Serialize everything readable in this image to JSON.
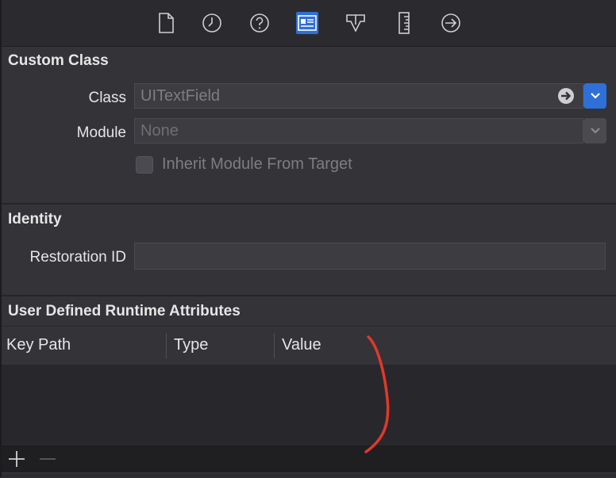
{
  "toolbar": {
    "icons": [
      "file-inspector-icon",
      "history-inspector-icon",
      "quick-help-icon",
      "identity-inspector-icon",
      "attributes-inspector-icon",
      "size-inspector-icon",
      "connections-inspector-icon"
    ],
    "active": "identity-inspector-icon",
    "accent": "#2f6fd8"
  },
  "custom_class": {
    "title": "Custom Class",
    "class_label": "Class",
    "class_value": "UITextField",
    "module_label": "Module",
    "module_placeholder": "None",
    "inherit_label": "Inherit Module From Target",
    "inherit_checked": false
  },
  "identity": {
    "title": "Identity",
    "restoration_label": "Restoration ID",
    "restoration_value": ""
  },
  "runtime_attributes": {
    "title": "User Defined Runtime Attributes",
    "columns": [
      "Key Path",
      "Type",
      "Value"
    ],
    "rows": [],
    "add_icon": "plus-icon",
    "remove_icon": "minus-icon"
  },
  "colors": {
    "background": "#333338",
    "annotation": "#e0392b"
  }
}
